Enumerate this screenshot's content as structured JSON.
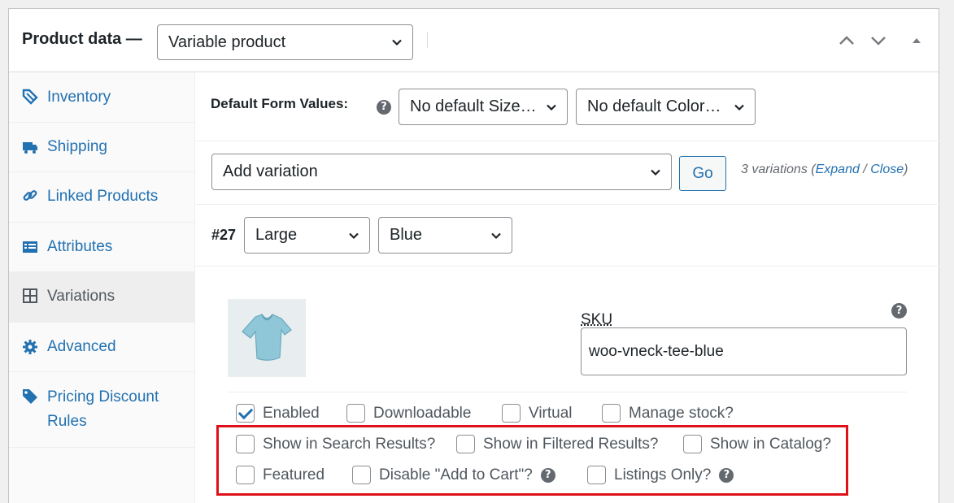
{
  "header": {
    "title": "Product data —",
    "product_type": "Variable product"
  },
  "sidebar": {
    "items": [
      {
        "label": "Inventory",
        "icon": "inventory-tag-icon"
      },
      {
        "label": "Shipping",
        "icon": "truck-icon"
      },
      {
        "label": "Linked Products",
        "icon": "link-icon"
      },
      {
        "label": "Attributes",
        "icon": "list-icon"
      },
      {
        "label": "Variations",
        "icon": "grid-icon"
      },
      {
        "label": "Advanced",
        "icon": "gear-icon"
      },
      {
        "label": "Pricing Discount Rules",
        "icon": "tag-icon"
      }
    ],
    "active": "Variations"
  },
  "defaults": {
    "label": "Default Form Values:",
    "size_select": "No default Size…",
    "color_select": "No default Color…"
  },
  "add_variation": {
    "select": "Add variation",
    "go_label": "Go",
    "count_text": "3 variations (",
    "expand": "Expand",
    "sep": " / ",
    "close": "Close",
    "close_paren": ")"
  },
  "variation": {
    "id": "#27",
    "size": "Large",
    "color": "Blue",
    "sku_label": "SKU",
    "sku_value": "woo-vneck-tee-blue",
    "checkboxes": {
      "enabled": {
        "label": "Enabled",
        "checked": true
      },
      "downloadable": {
        "label": "Downloadable",
        "checked": false
      },
      "virtual": {
        "label": "Virtual",
        "checked": false
      },
      "manage_stock": {
        "label": "Manage stock?",
        "checked": false
      },
      "search": {
        "label": "Show in Search Results?",
        "checked": false
      },
      "filtered": {
        "label": "Show in Filtered Results?",
        "checked": false
      },
      "catalog": {
        "label": "Show in Catalog?",
        "checked": false
      },
      "featured": {
        "label": "Featured",
        "checked": false
      },
      "disable_cart": {
        "label": "Disable \"Add to Cart\"?",
        "checked": false
      },
      "listings_only": {
        "label": "Listings Only?",
        "checked": false
      }
    }
  },
  "colors": {
    "accent": "#2271b1",
    "highlight": "#e0101a"
  }
}
